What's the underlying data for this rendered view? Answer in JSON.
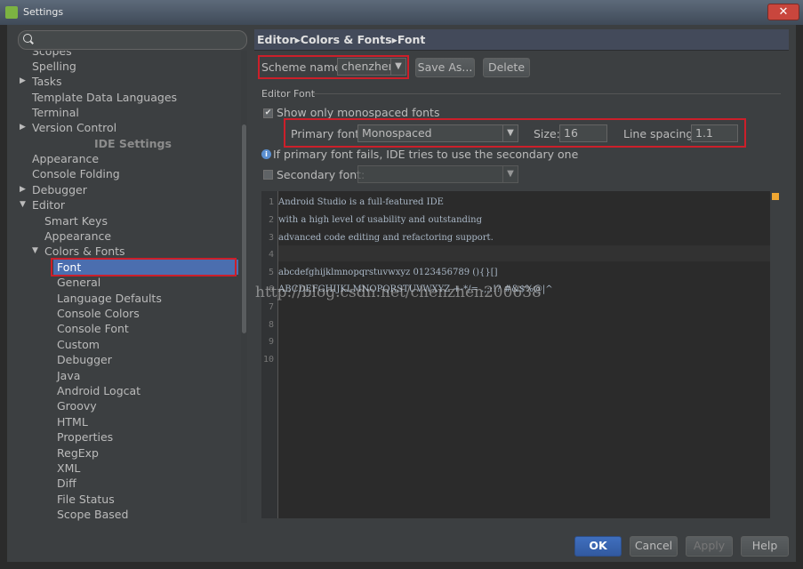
{
  "window": {
    "title": "Settings",
    "close_glyph": "✕"
  },
  "search": {
    "placeholder": "",
    "value": ""
  },
  "tree": {
    "items": [
      {
        "label": "Scopes"
      },
      {
        "label": "Spelling"
      },
      {
        "label": "Tasks"
      },
      {
        "label": "Template Data Languages"
      },
      {
        "label": "Terminal"
      },
      {
        "label": "Version Control"
      },
      {
        "label": "IDE Settings"
      },
      {
        "label": "Appearance"
      },
      {
        "label": "Console Folding"
      },
      {
        "label": "Debugger"
      },
      {
        "label": "Editor"
      },
      {
        "label": "Smart Keys"
      },
      {
        "label": "Appearance"
      },
      {
        "label": "Colors & Fonts"
      },
      {
        "label": "Font"
      },
      {
        "label": "General"
      },
      {
        "label": "Language Defaults"
      },
      {
        "label": "Console Colors"
      },
      {
        "label": "Console Font"
      },
      {
        "label": "Custom"
      },
      {
        "label": "Debugger"
      },
      {
        "label": "Java"
      },
      {
        "label": "Android Logcat"
      },
      {
        "label": "Groovy"
      },
      {
        "label": "HTML"
      },
      {
        "label": "Properties"
      },
      {
        "label": "RegExp"
      },
      {
        "label": "XML"
      },
      {
        "label": "Diff"
      },
      {
        "label": "File Status"
      },
      {
        "label": "Scope Based"
      }
    ],
    "expanded_arrow": "▼",
    "collapsed_arrow": "▶"
  },
  "breadcrumb": {
    "part1": "Editor",
    "sep": "▸",
    "part2": "Colors & Fonts",
    "part3": "Font"
  },
  "scheme": {
    "label": "Scheme name:",
    "value": "chenzhen",
    "save_as": "Save As...",
    "delete": "Delete"
  },
  "editor_font": {
    "group_title": "Editor Font",
    "monospaced_only": {
      "label": "Show only monospaced fonts",
      "checked": true
    },
    "primary_font": {
      "label": "Primary font:",
      "value": "Monospaced"
    },
    "size": {
      "label": "Size:",
      "value": "16"
    },
    "line_spacing": {
      "label": "Line spacing:",
      "value": "1.1"
    },
    "info_text": "If primary font fails, IDE tries to use the secondary one",
    "secondary_font": {
      "label": "Secondary font:",
      "value": "",
      "checked": false
    }
  },
  "preview": {
    "line_numbers": [
      "1",
      "2",
      "3",
      "4",
      "5",
      "6",
      "7",
      "8",
      "9",
      "10"
    ],
    "lines": [
      "Android Studio is a full-featured IDE",
      "with a high level of usability and outstanding",
      "advanced code editing and refactoring support.",
      "",
      "abcdefghijklmnopqrstuvwxyz 0123456789 (){}[]",
      "ABCDEFGHIJKLMNOPQRSTUVWXYZ +-*/= .,;:!? #&$%@|^"
    ]
  },
  "watermark": "http://blog.csdn.net/chenzhen200638",
  "buttons": {
    "ok": "OK",
    "cancel": "Cancel",
    "apply": "Apply",
    "help": "Help"
  },
  "colors": {
    "selection": "#4b6eaf",
    "highlight_red": "#cc1f2a",
    "primary_button": "#3f6fbe"
  }
}
